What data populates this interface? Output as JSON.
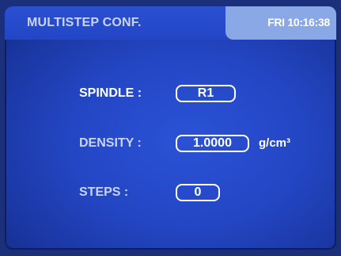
{
  "header": {
    "title": "MULTISTEP CONF.",
    "clock": "FRI 10:16:38"
  },
  "form": {
    "spindle": {
      "label": "SPINDLE :",
      "value": "R1"
    },
    "density": {
      "label": "DENSITY :",
      "value": "1.0000",
      "unit": "g/cm³"
    },
    "steps": {
      "label": "STEPS :",
      "value": "0"
    }
  }
}
